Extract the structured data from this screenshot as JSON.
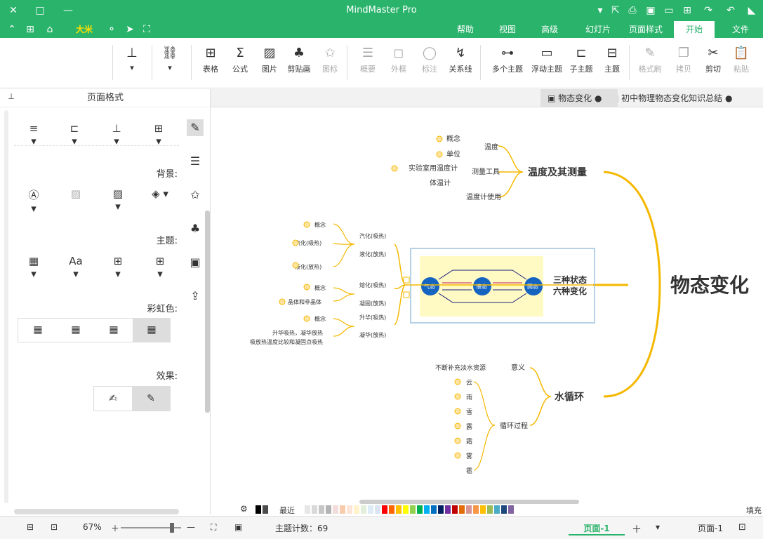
{
  "app": {
    "title": "MindMaster Pro",
    "brand_color": "#2ab36b"
  },
  "titlebar_icons": [
    "logo-icon",
    "back-icon",
    "forward-icon",
    "new-icon",
    "open-icon",
    "save-icon",
    "print-icon",
    "export-icon",
    "dropdown-icon",
    "minimize-icon",
    "maximize-icon",
    "close-icon"
  ],
  "menu": {
    "tabs": [
      "文件",
      "开始",
      "页面样式",
      "幻灯片",
      "高级",
      "视图",
      "帮助"
    ],
    "active": "开始",
    "extra": "大米"
  },
  "toolbar": {
    "items": [
      "粘贴",
      "剪切",
      "拷贝",
      "格式刷",
      "主题",
      "子主题",
      "浮动主题",
      "多个主题",
      "关系线",
      "标注",
      "外框",
      "概要",
      "图标",
      "剪贴画",
      "图片",
      "公式",
      "表格"
    ]
  },
  "doctabs": [
    {
      "label": "初中物理物态变化知识总结"
    },
    {
      "label": "物态变化"
    }
  ],
  "left_panel": {
    "title": "页面格式",
    "sections": {
      "background": "背景:",
      "theme": "主题:",
      "rainbow": "彩虹色:",
      "effect": "效果:"
    }
  },
  "mindmap": {
    "central": "物态变化",
    "b1": {
      "title": "温度及其测量",
      "children": [
        "温度",
        "测量工具",
        "温度计使用"
      ],
      "g1": [
        "概念",
        "单位"
      ],
      "g2": [
        "实验室用温度计",
        "体温计"
      ]
    },
    "b2": {
      "title": "三种状态\n六种变化",
      "states": [
        "固态",
        "液态",
        "气态"
      ]
    },
    "b3": {
      "title": "水循环",
      "meaning": "意义",
      "meaning_text": "不断补充淡水资源",
      "cycle": "循环过程",
      "items": [
        "云",
        "雨",
        "雪",
        "露",
        "霜",
        "雾",
        "雹"
      ]
    },
    "left": {
      "groups": [
        {
          "pair": [
            "汽化(吸热)",
            "液化(放热)"
          ],
          "items": [
            "概念",
            "汽化(吸热)",
            "液化(放热)"
          ]
        },
        {
          "pair": [
            "熔化(吸热)",
            "凝固(放热)"
          ],
          "items": [
            "概念",
            "晶体和非晶体"
          ]
        },
        {
          "pair": [
            "升华(吸热)",
            "凝华(放热)"
          ],
          "items": [
            "概念",
            "升华吸热，凝华放热",
            "吸放热温度比较和凝固点吸热"
          ]
        }
      ]
    },
    "image_labels": {
      "top": "升华\n(吸热)",
      "l1": "汽化\n(吸热)",
      "l2": "液化\n(放热)",
      "r1": "熔化\n(吸热)",
      "r2": "凝固\n(放热)",
      "bottom": "凝华\n(放热)"
    }
  },
  "status": {
    "topic_count": "主题计数：69",
    "zoom": "67%",
    "page": "页面-1",
    "page_tab": "页面-1",
    "fill": "填充",
    "recent": "最近"
  },
  "palette": [
    "#000000",
    "#4d4d4d",
    "#ffffff",
    "#e6e6e6",
    "#d9d9d9",
    "#c6c6c6",
    "#b3b3b3",
    "#f2dcdb",
    "#f8cbad",
    "#fce4d6",
    "#fff2cc",
    "#e2efda",
    "#ddebf7",
    "#dbe5f1",
    "#ff0000",
    "#ff6600",
    "#ffc000",
    "#ffff00",
    "#92d050",
    "#00b050",
    "#00b0f0",
    "#0070c0",
    "#002060",
    "#7030a0",
    "#c00000",
    "#e36c09",
    "#d99594",
    "#f79646",
    "#ffc000",
    "#9bbb59",
    "#4bacc6",
    "#1f497d",
    "#8064a2"
  ]
}
